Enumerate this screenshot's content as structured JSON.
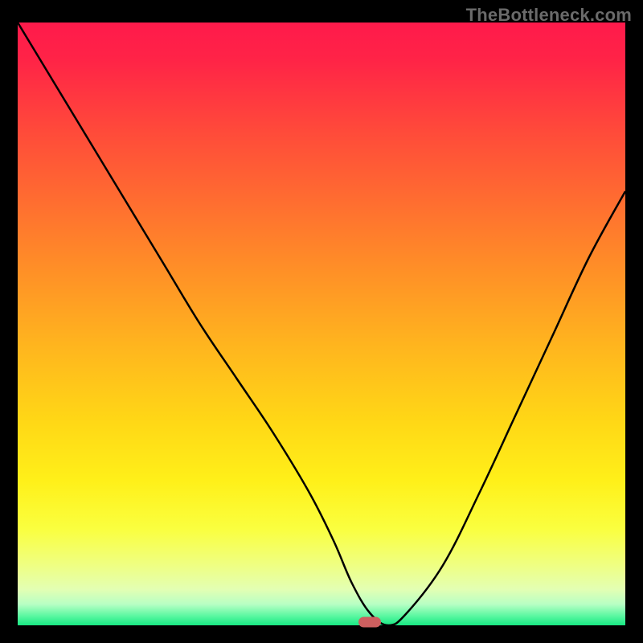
{
  "watermark": "TheBottleneck.com",
  "chart_data": {
    "type": "line",
    "title": "",
    "xlabel": "",
    "ylabel": "",
    "xlim": [
      0,
      100
    ],
    "ylim": [
      0,
      100
    ],
    "grid": false,
    "series": [
      {
        "name": "bottleneck-curve",
        "x": [
          0,
          6,
          12,
          18,
          24,
          30,
          36,
          42,
          48,
          52,
          55,
          58,
          61,
          64,
          70,
          76,
          82,
          88,
          94,
          100
        ],
        "values": [
          100,
          90,
          80,
          70,
          60,
          50,
          41,
          32,
          22,
          14,
          7,
          2,
          0,
          2,
          10,
          22,
          35,
          48,
          61,
          72
        ]
      }
    ],
    "annotations": [
      {
        "name": "min-marker",
        "x": 58,
        "y": 0,
        "color": "#cd5f5f"
      }
    ],
    "background_gradient_stops": [
      {
        "offset": 0.0,
        "color": "#ff1a4b"
      },
      {
        "offset": 0.06,
        "color": "#ff2347"
      },
      {
        "offset": 0.18,
        "color": "#ff4a3a"
      },
      {
        "offset": 0.3,
        "color": "#ff6e30"
      },
      {
        "offset": 0.42,
        "color": "#ff9226"
      },
      {
        "offset": 0.54,
        "color": "#ffb61e"
      },
      {
        "offset": 0.66,
        "color": "#ffd716"
      },
      {
        "offset": 0.76,
        "color": "#fff019"
      },
      {
        "offset": 0.84,
        "color": "#faff3f"
      },
      {
        "offset": 0.9,
        "color": "#efff82"
      },
      {
        "offset": 0.94,
        "color": "#e3ffb3"
      },
      {
        "offset": 0.965,
        "color": "#b8ffc4"
      },
      {
        "offset": 0.985,
        "color": "#58f7a0"
      },
      {
        "offset": 1.0,
        "color": "#18e883"
      }
    ],
    "curve_stroke": "#000000",
    "curve_width": 2.5
  }
}
